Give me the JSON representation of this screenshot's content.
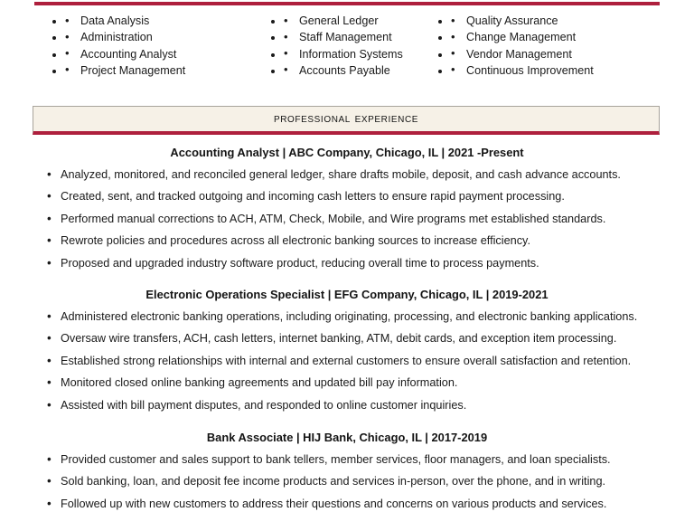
{
  "colors": {
    "accent_rule": "#AE1F3D",
    "band_background": "#F6F1E7",
    "band_border": "#A8A49C",
    "text": "#1A1A1A"
  },
  "skills": {
    "columns": [
      {
        "items": [
          "Data Analysis",
          "Administration",
          "Accounting Analyst",
          "Project Management"
        ]
      },
      {
        "items": [
          "General Ledger",
          "Staff Management",
          "Information Systems",
          "Accounts Payable"
        ]
      },
      {
        "items": [
          "Quality Assurance",
          "Change Management",
          "Vendor Management",
          "Continuous Improvement"
        ]
      }
    ]
  },
  "section": {
    "title": "Professional Experience"
  },
  "experience": {
    "jobs": [
      {
        "heading": "Accounting Analyst |  ABC Company, Chicago, IL | 2021 -Present",
        "title": "Accounting Analyst",
        "company": "ABC Company",
        "location": "Chicago, IL",
        "dates": "2021 -Present",
        "bullets": [
          "Analyzed, monitored, and reconciled general ledger, share drafts mobile, deposit, and cash advance accounts.",
          "Created, sent, and tracked outgoing and incoming cash letters to ensure rapid payment processing.",
          "Performed  manual corrections to ACH, ATM, Check, Mobile, and Wire programs met established standards.",
          "Rewrote policies and procedures across all electronic banking sources to increase efficiency.",
          "Proposed and upgraded industry software product, reducing overall time to process payments."
        ]
      },
      {
        "heading": "Electronic Operations Specialist | EFG Company, Chicago, IL | 2019-2021",
        "title": "Electronic Operations Specialist",
        "company": "EFG Company",
        "location": "Chicago, IL",
        "dates": "2019-2021",
        "bullets": [
          "Administered electronic banking operations, including originating, processing, and electronic banking applications.",
          "Oversaw wire transfers, ACH, cash letters, internet banking, ATM, debit cards, and exception item processing.",
          "Established strong relationships with internal and external customers to ensure overall satisfaction and retention.",
          "Monitored closed online banking agreements and updated bill pay information.",
          "Assisted with bill payment disputes, and responded to online customer inquiries."
        ]
      },
      {
        "heading": "Bank Associate | HIJ Bank, Chicago, IL | 2017-2019",
        "title": "Bank Associate",
        "company": "HIJ Bank",
        "location": "Chicago, IL",
        "dates": "2017-2019",
        "bullets": [
          "Provided customer and sales support to bank tellers, member services, floor managers, and loan specialists.",
          "Sold banking, loan, and deposit fee income products and services in-person, over the phone, and in writing.",
          "Followed up with new customers to address their questions and concerns on various products and services."
        ]
      }
    ]
  }
}
